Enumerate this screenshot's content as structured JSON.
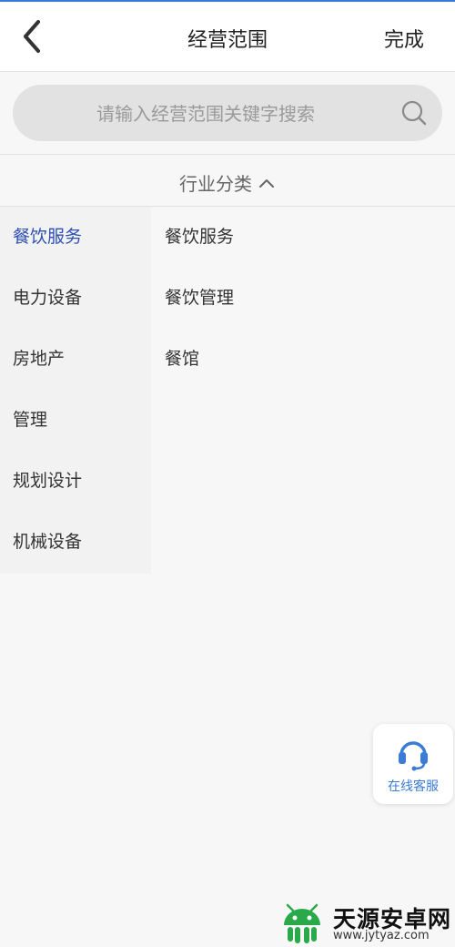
{
  "header": {
    "title": "经营范围",
    "done_label": "完成"
  },
  "search": {
    "placeholder": "请输入经营范围关键字搜索"
  },
  "category_toggle": {
    "label": "行业分类"
  },
  "left_categories": [
    {
      "label": "餐饮服务",
      "active": true
    },
    {
      "label": "电力设备"
    },
    {
      "label": "房地产"
    },
    {
      "label": "管理"
    },
    {
      "label": "规划设计"
    },
    {
      "label": "机械设备"
    }
  ],
  "right_items": [
    {
      "label": "餐饮服务"
    },
    {
      "label": "餐饮管理"
    },
    {
      "label": "餐馆"
    }
  ],
  "customer_service": {
    "label": "在线客服",
    "icon": "headset-icon"
  },
  "watermark": {
    "name": "天源安卓网",
    "url": "www.jytyaz.com"
  },
  "colors": {
    "accent": "#2d4fb3",
    "service_blue": "#3a7bd5",
    "watermark_green": "#2aa94b"
  }
}
